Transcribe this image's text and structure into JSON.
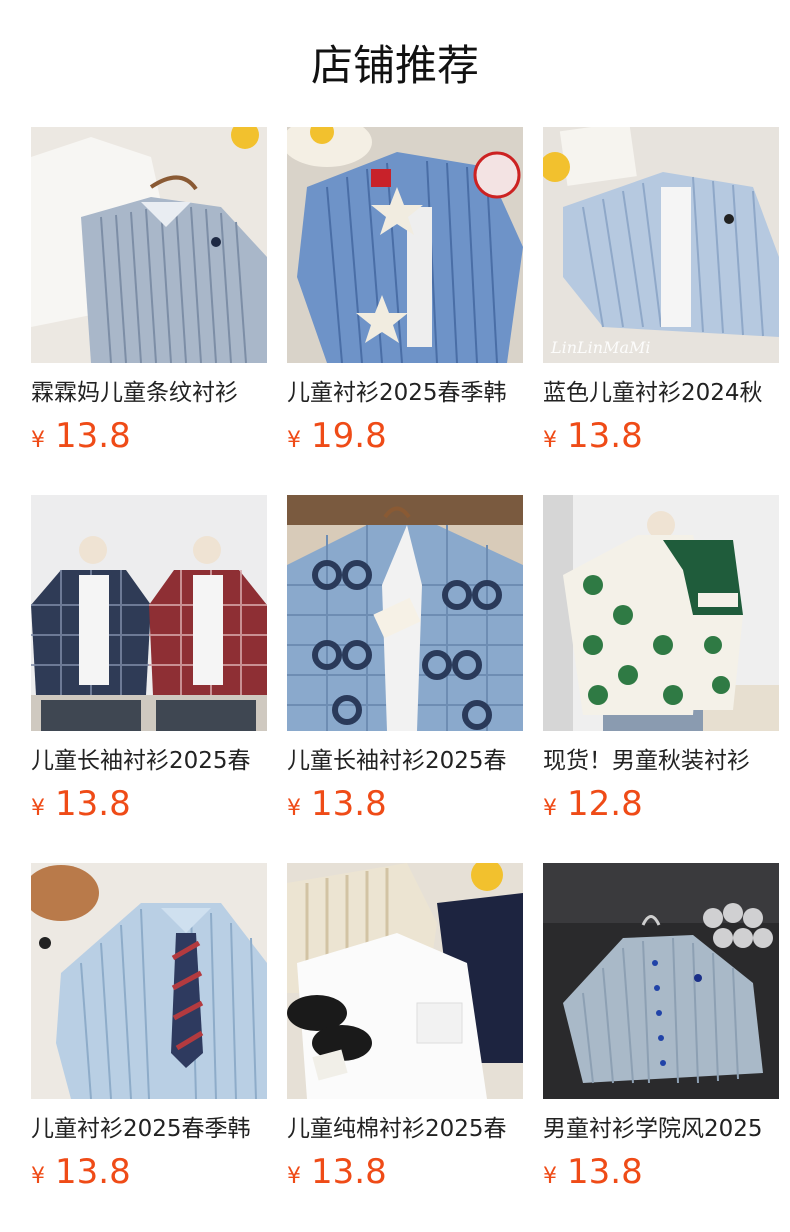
{
  "header": {
    "title": "店铺推荐"
  },
  "currency_symbol": "¥",
  "products": [
    {
      "name": "霖霖妈儿童条纹衬衫",
      "price": "13.8",
      "image": "blue-white-striped-shirt-photo"
    },
    {
      "name": "儿童衬衫2025春季韩",
      "price": "19.8",
      "image": "striped-shirt-with-star-patches-photo"
    },
    {
      "name": "蓝色儿童衬衫2024秋",
      "price": "13.8",
      "image": "light-blue-striped-shirt-photo",
      "watermark": "LinLinMaMi"
    },
    {
      "name": "儿童长袖衬衫2025春",
      "price": "13.8",
      "image": "plaid-shirts-on-mannequins-photo"
    },
    {
      "name": "儿童长袖衬衫2025春",
      "price": "13.8",
      "image": "blue-gg-print-shirt-photo"
    },
    {
      "name": "现货！男童秋装衬衫",
      "price": "12.8",
      "image": "green-bear-print-shirt-photo"
    },
    {
      "name": "儿童衬衫2025春季韩",
      "price": "13.8",
      "image": "striped-shirt-with-tie-photo"
    },
    {
      "name": "儿童纯棉衬衫2025春",
      "price": "13.8",
      "image": "white-shirt-with-shoes-photo"
    },
    {
      "name": "男童衬衫学院风2025",
      "price": "13.8",
      "image": "grey-striped-shirt-on-hanger-photo"
    }
  ]
}
